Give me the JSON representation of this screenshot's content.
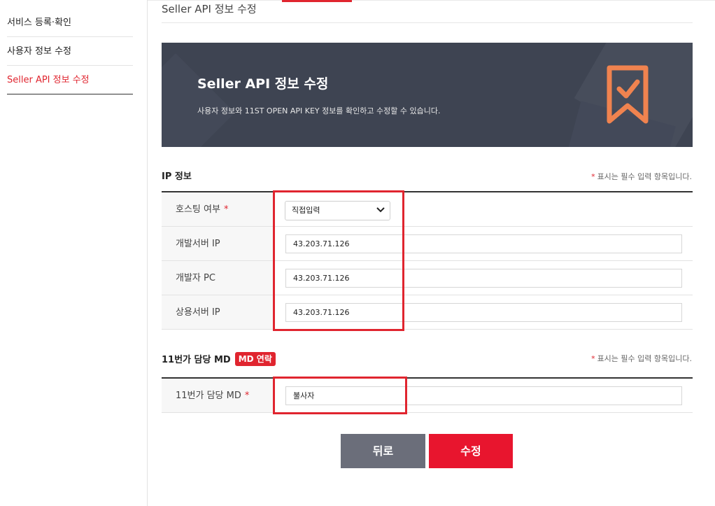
{
  "sidebar": {
    "items": [
      {
        "label": "서비스 등록·확인",
        "active": false
      },
      {
        "label": "사용자 정보 수정",
        "active": false
      },
      {
        "label": "Seller API 정보 수정",
        "active": true
      }
    ]
  },
  "page": {
    "title": "Seller API 정보 수정"
  },
  "banner": {
    "title": "Seller API 정보 수정",
    "description": "사용자 정보와 11ST OPEN API KEY 정보를 확인하고 수정할 수 있습니다.",
    "icon": "bookmark-check-icon",
    "icon_color": "#f0834f",
    "background": "#3e4452"
  },
  "ip_section": {
    "title": "IP 정보",
    "required_note": "표시는 필수 입력 항목입니다.",
    "rows": {
      "hosting": {
        "label": "호스팅 여부",
        "selected": "직접입력"
      },
      "dev_server": {
        "label": "개발서버 IP",
        "value": "43.203.71.126"
      },
      "dev_pc": {
        "label": "개발자 PC",
        "value": "43.203.71.126"
      },
      "prod_server": {
        "label": "상용서버 IP",
        "value": "43.203.71.126"
      }
    }
  },
  "md_section": {
    "title": "11번가 담당 MD",
    "badge": "MD 연락",
    "required_note": "표시는 필수 입력 항목입니다.",
    "row": {
      "label": "11번가 담당 MD",
      "value": "불사자"
    }
  },
  "buttons": {
    "back": "뒤로",
    "submit": "수정"
  },
  "colors": {
    "accent": "#e0252f",
    "back_button": "#6b6e7a",
    "submit_button": "#e8152e"
  },
  "star": "*"
}
